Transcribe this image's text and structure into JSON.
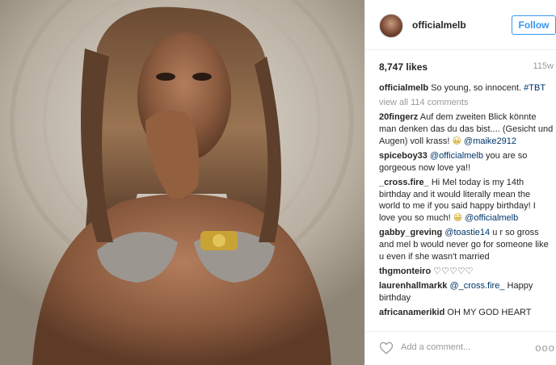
{
  "post": {
    "username": "officialmelb",
    "follow_label": "Follow",
    "likes": "8,747 likes",
    "time": "115w",
    "caption_user": "officialmelb",
    "caption_text": "So young, so innocent.",
    "caption_tag": "#TBT",
    "view_all": "view all 114 comments"
  },
  "comments": [
    {
      "user": "20fingerz",
      "text": "Auf dem zweiten Blick könnte man denken das du das bist.... (Gesicht und Augen) voll krass!",
      "emoji": "😀",
      "mention": "@maike2912",
      "after": ""
    },
    {
      "user": "spiceboy33",
      "mention_before": "@officialmelb",
      "text": "you are so gorgeous now love ya!!"
    },
    {
      "user": "_cross.fire_",
      "text": "Hi Mel today is my 14th birthday and it would literally mean the world to me if you said happy birthday! I love you so much!",
      "emoji": "😁",
      "mention": "@officialmelb"
    },
    {
      "user": "gabby_greving",
      "mention_before": "@toastie14",
      "text": "u r so gross and mel b would never go for someone like u even if she wasn't married"
    },
    {
      "user": "thgmonteiro",
      "text": "♡♡♡♡♡"
    },
    {
      "user": "laurenhallmarkk",
      "mention_before": "@_cross.fire_",
      "text": "Happy birthday"
    },
    {
      "user": "africanamerikid",
      "text": "OH MY GOD HEART"
    }
  ],
  "footer": {
    "add_comment_placeholder": "Add a comment...",
    "more_label": "ooo"
  },
  "icons": {
    "heart": "heart-icon",
    "more": "more-options-icon"
  },
  "colors": {
    "link": "#003569",
    "follow": "#3897f0",
    "muted": "#999999"
  }
}
